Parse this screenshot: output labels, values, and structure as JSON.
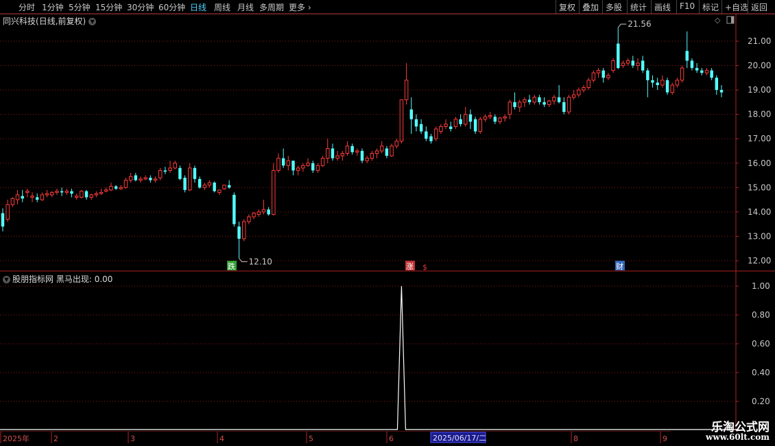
{
  "toolbar": {
    "timeframes": [
      "分时",
      "1分钟",
      "5分钟",
      "15分钟",
      "30分钟",
      "60分钟",
      "日线",
      "周线",
      "月线",
      "多周期",
      "更多"
    ],
    "active_timeframe": "日线",
    "right_buttons": [
      "复权",
      "叠加",
      "多股",
      "统计",
      "画线",
      "F10",
      "标记",
      "+自选",
      "返回"
    ]
  },
  "chart": {
    "stock_name": "同兴科技",
    "period_label": "(日线,前复权)",
    "high_label": "21.56",
    "low_label": "12.10",
    "markers": [
      {
        "text": "跌",
        "color": "#3cb93c"
      },
      {
        "text": "涨",
        "color": "#e03c3c"
      },
      {
        "text": "$",
        "color": "#e03c3c"
      },
      {
        "text": "财",
        "color": "#3c78d8"
      }
    ],
    "price_axis": [
      "21.00",
      "20.00",
      "19.00",
      "18.00",
      "17.00",
      "16.00",
      "15.00",
      "14.00",
      "13.00",
      "12.00"
    ],
    "colors": {
      "up": "#ff3c3c",
      "down": "#54ffff",
      "grid": "#8b1a1a",
      "axis": "#b22222"
    }
  },
  "indicator": {
    "title": "股朋指标网",
    "name": "黑马出现:",
    "value": "0.00",
    "axis": [
      "1.00",
      "0.80",
      "0.60",
      "0.40",
      "0.20"
    ],
    "signal_day_index": 81
  },
  "date_axis": {
    "labels": [
      "2025年",
      "2",
      "3",
      "4",
      "5",
      "6",
      "8",
      "9"
    ],
    "cursor_date": "2025/06/17/二"
  },
  "watermark": {
    "line1": "乐淘公式网",
    "line2": "www.60lt.com"
  },
  "chart_data": {
    "type": "candlestick",
    "title": "同兴科技(日线,前复权)",
    "y_range": [
      11.8,
      21.8
    ],
    "high": 21.56,
    "low": 12.1,
    "ohlc": [
      [
        13.95,
        14.15,
        13.4,
        13.2
      ],
      [
        13.7,
        14.5,
        14.3,
        13.6
      ],
      [
        14.3,
        14.6,
        14.55,
        14.2
      ],
      [
        14.5,
        14.9,
        14.7,
        14.3
      ],
      [
        14.65,
        14.9,
        14.55,
        14.4
      ],
      [
        14.8,
        14.95,
        14.85,
        14.6
      ],
      [
        14.6,
        14.8,
        14.65,
        14.4
      ],
      [
        14.6,
        14.75,
        14.5,
        14.4
      ],
      [
        14.5,
        14.8,
        14.7,
        14.45
      ],
      [
        14.7,
        14.9,
        14.75,
        14.6
      ],
      [
        14.7,
        14.85,
        14.8,
        14.6
      ],
      [
        14.8,
        14.95,
        14.85,
        14.7
      ],
      [
        14.85,
        15.0,
        14.8,
        14.65
      ],
      [
        14.8,
        14.95,
        14.85,
        14.7
      ],
      [
        14.85,
        14.95,
        14.75,
        14.6
      ],
      [
        14.6,
        14.75,
        14.65,
        14.5
      ],
      [
        14.6,
        14.9,
        14.85,
        14.55
      ],
      [
        14.85,
        14.9,
        14.6,
        14.5
      ],
      [
        14.6,
        14.75,
        14.7,
        14.5
      ],
      [
        14.7,
        14.85,
        14.75,
        14.6
      ],
      [
        14.75,
        14.95,
        14.8,
        14.7
      ],
      [
        14.85,
        15.0,
        14.9,
        14.8
      ],
      [
        14.9,
        15.2,
        15.05,
        14.85
      ],
      [
        15.05,
        15.1,
        14.95,
        14.9
      ],
      [
        14.95,
        15.1,
        15.0,
        14.9
      ],
      [
        15.0,
        15.4,
        15.3,
        14.95
      ],
      [
        15.3,
        15.6,
        15.45,
        15.2
      ],
      [
        15.5,
        15.6,
        15.3,
        15.25
      ],
      [
        15.3,
        15.45,
        15.35,
        15.2
      ],
      [
        15.35,
        15.5,
        15.4,
        15.3
      ],
      [
        15.4,
        15.5,
        15.3,
        15.2
      ],
      [
        15.3,
        15.45,
        15.35,
        15.2
      ],
      [
        15.4,
        15.8,
        15.7,
        15.3
      ],
      [
        15.7,
        15.85,
        15.65,
        15.55
      ],
      [
        15.7,
        16.1,
        15.8,
        15.6
      ],
      [
        15.8,
        16.1,
        16.0,
        15.75
      ],
      [
        15.8,
        15.9,
        15.35,
        15.3
      ],
      [
        15.4,
        15.5,
        14.9,
        14.8
      ],
      [
        14.9,
        16.0,
        15.8,
        14.85
      ],
      [
        15.8,
        15.9,
        15.35,
        15.2
      ],
      [
        15.35,
        15.45,
        15.0,
        14.95
      ],
      [
        15.0,
        15.2,
        15.1,
        14.9
      ],
      [
        15.1,
        15.3,
        15.2,
        15.0
      ],
      [
        15.2,
        15.25,
        14.85,
        14.8
      ],
      [
        14.8,
        14.9,
        14.9,
        14.7
      ],
      [
        14.95,
        15.0,
        15.1,
        14.9
      ],
      [
        15.1,
        15.3,
        15.0,
        14.95
      ],
      [
        14.7,
        14.8,
        13.5,
        13.4
      ],
      [
        13.4,
        13.6,
        12.9,
        12.1
      ],
      [
        12.9,
        13.7,
        13.6,
        12.8
      ],
      [
        13.6,
        13.9,
        13.8,
        13.5
      ],
      [
        13.8,
        14.0,
        13.95,
        13.7
      ],
      [
        13.9,
        14.1,
        14.0,
        13.8
      ],
      [
        14.0,
        14.5,
        14.1,
        13.9
      ],
      [
        14.1,
        14.2,
        13.9,
        13.85
      ],
      [
        13.9,
        16.0,
        15.7,
        13.85
      ],
      [
        15.7,
        16.4,
        16.2,
        15.6
      ],
      [
        16.2,
        16.6,
        15.9,
        15.8
      ],
      [
        15.9,
        16.3,
        16.1,
        15.7
      ],
      [
        16.1,
        16.1,
        15.7,
        15.5
      ],
      [
        15.7,
        15.9,
        15.8,
        15.5
      ],
      [
        15.8,
        16.0,
        15.9,
        15.65
      ],
      [
        15.9,
        16.2,
        16.0,
        15.85
      ],
      [
        16.0,
        16.1,
        15.7,
        15.6
      ],
      [
        15.7,
        16.0,
        15.9,
        15.6
      ],
      [
        15.9,
        16.3,
        16.2,
        15.85
      ],
      [
        16.2,
        17.0,
        16.6,
        16.0
      ],
      [
        16.6,
        16.8,
        16.2,
        16.1
      ],
      [
        16.2,
        16.5,
        16.3,
        16.1
      ],
      [
        16.3,
        16.5,
        16.4,
        16.1
      ],
      [
        16.4,
        16.9,
        16.7,
        16.3
      ],
      [
        16.7,
        16.8,
        16.45,
        16.35
      ],
      [
        16.45,
        16.6,
        16.5,
        16.3
      ],
      [
        16.5,
        16.6,
        16.1,
        16.0
      ],
      [
        16.1,
        16.3,
        16.2,
        16.0
      ],
      [
        16.2,
        16.5,
        16.4,
        16.1
      ],
      [
        16.4,
        16.6,
        16.5,
        16.2
      ],
      [
        16.5,
        16.9,
        16.7,
        16.4
      ],
      [
        16.6,
        16.7,
        16.3,
        16.2
      ],
      [
        16.3,
        16.8,
        16.7,
        16.25
      ],
      [
        16.7,
        17.0,
        16.9,
        16.6
      ],
      [
        16.9,
        18.6,
        18.6,
        16.8
      ],
      [
        18.6,
        20.1,
        19.4,
        18.4
      ],
      [
        18.2,
        18.7,
        17.8,
        17.2
      ],
      [
        17.8,
        18.0,
        17.5,
        17.3
      ],
      [
        17.6,
        17.8,
        17.3,
        17.2
      ],
      [
        17.3,
        17.5,
        17.0,
        16.9
      ],
      [
        17.1,
        17.2,
        16.9,
        16.8
      ],
      [
        17.0,
        17.5,
        17.4,
        16.9
      ],
      [
        17.3,
        17.6,
        17.5,
        17.2
      ],
      [
        17.5,
        17.8,
        17.6,
        17.4
      ],
      [
        17.5,
        17.7,
        17.4,
        17.3
      ],
      [
        17.5,
        17.9,
        17.8,
        17.4
      ],
      [
        17.8,
        18.0,
        17.6,
        17.5
      ],
      [
        17.6,
        18.3,
        18.0,
        17.5
      ],
      [
        18.0,
        18.2,
        17.7,
        17.4
      ],
      [
        17.8,
        17.9,
        17.3,
        17.2
      ],
      [
        17.3,
        17.9,
        17.8,
        17.2
      ],
      [
        17.8,
        18.0,
        17.9,
        17.7
      ],
      [
        17.9,
        18.1,
        17.95,
        17.8
      ],
      [
        17.9,
        18.0,
        17.7,
        17.6
      ],
      [
        17.7,
        17.9,
        17.85,
        17.6
      ],
      [
        17.85,
        18.0,
        17.9,
        17.7
      ],
      [
        18.0,
        18.6,
        18.5,
        17.8
      ],
      [
        18.5,
        18.9,
        18.3,
        18.2
      ],
      [
        18.3,
        18.6,
        18.5,
        18.1
      ],
      [
        18.5,
        18.7,
        18.6,
        18.3
      ],
      [
        18.6,
        18.8,
        18.5,
        18.4
      ],
      [
        18.5,
        18.8,
        18.7,
        18.4
      ],
      [
        18.7,
        18.8,
        18.5,
        18.4
      ],
      [
        18.5,
        18.7,
        18.4,
        18.3
      ],
      [
        18.4,
        18.6,
        18.55,
        18.3
      ],
      [
        18.55,
        18.8,
        18.7,
        18.4
      ],
      [
        18.7,
        19.2,
        18.5,
        18.45
      ],
      [
        18.5,
        18.7,
        18.1,
        18.0
      ],
      [
        18.1,
        18.8,
        18.7,
        18.0
      ],
      [
        18.7,
        19.0,
        18.8,
        18.6
      ],
      [
        18.8,
        19.1,
        19.0,
        18.7
      ],
      [
        19.0,
        19.2,
        19.1,
        18.9
      ],
      [
        19.1,
        19.5,
        19.4,
        19.0
      ],
      [
        19.4,
        19.8,
        19.7,
        19.3
      ],
      [
        19.7,
        19.9,
        19.8,
        19.5
      ],
      [
        19.8,
        19.9,
        19.5,
        19.3
      ],
      [
        19.5,
        19.7,
        19.6,
        19.4
      ],
      [
        19.8,
        20.3,
        20.2,
        19.7
      ],
      [
        20.9,
        21.56,
        19.9,
        19.85
      ],
      [
        20.0,
        20.2,
        20.1,
        19.9
      ],
      [
        20.1,
        20.3,
        20.2,
        20.0
      ],
      [
        20.2,
        20.4,
        20.0,
        19.9
      ],
      [
        20.0,
        20.3,
        20.1,
        19.8
      ],
      [
        20.2,
        20.4,
        19.8,
        19.7
      ],
      [
        19.8,
        19.9,
        19.4,
        18.7
      ],
      [
        19.4,
        19.6,
        19.3,
        19.1
      ],
      [
        19.3,
        19.5,
        19.2,
        19.0
      ],
      [
        19.2,
        19.6,
        19.4,
        19.1
      ],
      [
        19.4,
        19.5,
        18.9,
        18.8
      ],
      [
        18.9,
        19.3,
        19.2,
        18.8
      ],
      [
        19.2,
        19.5,
        19.4,
        19.1
      ],
      [
        19.4,
        20.0,
        19.9,
        19.3
      ],
      [
        20.6,
        21.4,
        20.2,
        19.9
      ],
      [
        20.2,
        20.3,
        19.9,
        19.8
      ],
      [
        19.9,
        20.1,
        19.8,
        19.7
      ],
      [
        19.8,
        19.9,
        19.7,
        19.6
      ],
      [
        19.7,
        19.9,
        19.8,
        19.6
      ],
      [
        19.8,
        19.9,
        19.5,
        19.4
      ],
      [
        19.5,
        19.6,
        19.0,
        18.8
      ],
      [
        19.0,
        19.2,
        18.9,
        18.7
      ]
    ]
  }
}
